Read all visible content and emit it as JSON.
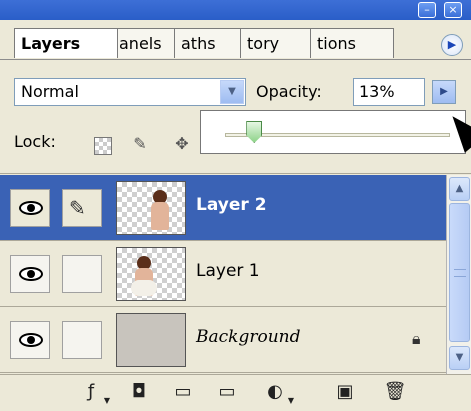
{
  "tabs": [
    {
      "label": "Layers",
      "active": true
    },
    {
      "label": "anels",
      "active": false
    },
    {
      "label": "aths",
      "active": false
    },
    {
      "label": "tory",
      "active": false
    },
    {
      "label": "tions",
      "active": false
    }
  ],
  "blend": {
    "mode": "Normal",
    "opacity_label": "Opacity:",
    "opacity_value": "13%"
  },
  "opacity_slider": {
    "value_percent": 13
  },
  "lock": {
    "label": "Lock:"
  },
  "layers": [
    {
      "name": "Layer 2",
      "selected": true,
      "visible": true,
      "thumbnail": "portrait-transparent"
    },
    {
      "name": "Layer 1",
      "selected": false,
      "visible": true,
      "thumbnail": "portrait-transparent"
    },
    {
      "name": "Background",
      "selected": false,
      "visible": true,
      "thumbnail": "solid-gray",
      "locked": true
    }
  ],
  "icons": {
    "eye": "eye-icon",
    "brush": "brush-icon",
    "lock": "lock-icon",
    "bottom_bar": [
      "link-layers-icon",
      "layer-style-icon",
      "layer-mask-icon",
      "new-group-icon",
      "adjustment-layer-icon",
      "new-layer-icon",
      "trash-icon"
    ]
  },
  "colors": {
    "selection": "#3a62b5",
    "titlebar": "#2a5ec8",
    "panel": "#ece9d8"
  }
}
